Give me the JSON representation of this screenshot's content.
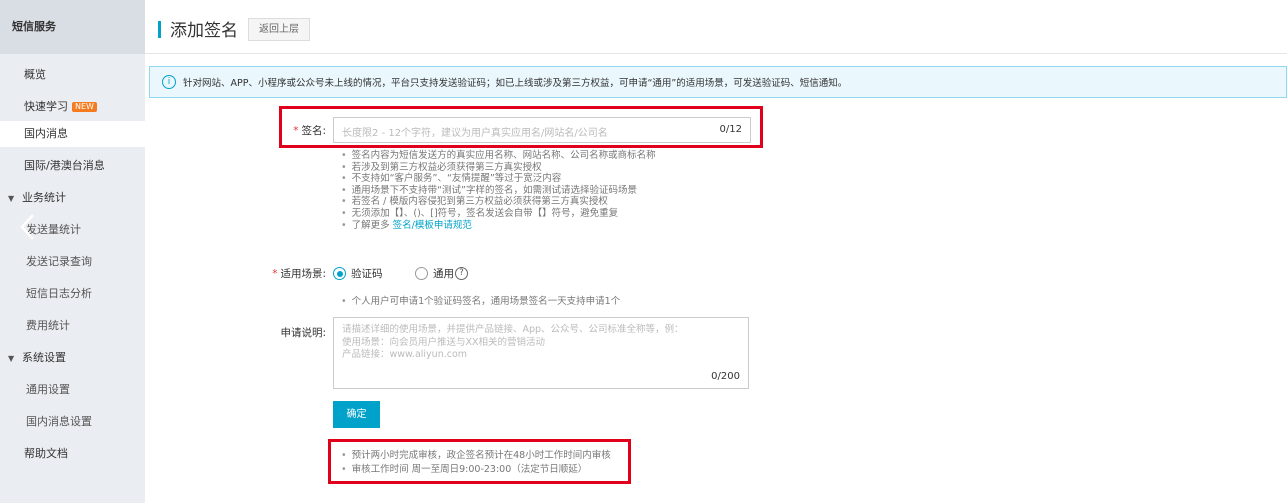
{
  "sidebar": {
    "header": "短信服务",
    "items": [
      {
        "label": "概览"
      },
      {
        "label": "快速学习",
        "badge": "NEW"
      },
      {
        "label": "国内消息"
      },
      {
        "label": "国际/港澳台消息"
      },
      {
        "label": "业务统计"
      },
      {
        "label": "发送量统计"
      },
      {
        "label": "发送记录查询"
      },
      {
        "label": "短信日志分析"
      },
      {
        "label": "费用统计"
      },
      {
        "label": "系统设置"
      },
      {
        "label": "通用设置"
      },
      {
        "label": "国内消息设置"
      },
      {
        "label": "帮助文档"
      }
    ]
  },
  "header": {
    "title": "添加签名",
    "back_label": "返回上层"
  },
  "notice": {
    "icon": "info-icon",
    "text": "针对网站、APP、小程序或公众号未上线的情况，平台只支持发送验证码；如已上线或涉及第三方权益，可申请“通用”的适用场景，可发送验证码、短信通知。"
  },
  "form": {
    "required_mark": "*",
    "signature": {
      "label": "签名:",
      "placeholder": "长度限2 - 12个字符，建议为用户真实应用名/网站名/公司名",
      "counter": "0/12"
    },
    "tips": [
      "签名内容为短信发送方的真实应用名称、网站名称、公司名称或商标名称",
      "若涉及到第三方权益必须获得第三方真实授权",
      "不支持如“客户服务”、“友情提醒”等过于宽泛内容",
      "通用场景下不支持带“测试”字样的签名，如需测试请选择验证码场景",
      "若签名 / 模版内容侵犯到第三方权益必须获得第三方真实授权",
      "无须添加【】、()、[]符号，签名发送会自带【】符号，避免重复"
    ],
    "tips_more_prefix": "了解更多",
    "tips_more_link": "签名/模板申请规范",
    "scene": {
      "label": "适用场景:",
      "option1": "验证码",
      "option2": "通用",
      "help": "?",
      "tip": "个人用户可申请1个验证码签名，通用场景签名一天支持申请1个"
    },
    "description": {
      "label": "申请说明:",
      "placeholder": "请描述详细的使用场景，并提供产品链接、App、公众号、公司标准全称等，例：\n使用场景：向会员用户推送与XX相关的营销活动\n产品链接：www.aliyun.com",
      "counter": "0/200"
    },
    "submit_label": "确定",
    "bottom_tips": [
      "预计两小时完成审核，政企签名预计在48小时工作时间内审核",
      "审核工作时间 周一至周日9:00-23:00（法定节日顺延）"
    ]
  }
}
